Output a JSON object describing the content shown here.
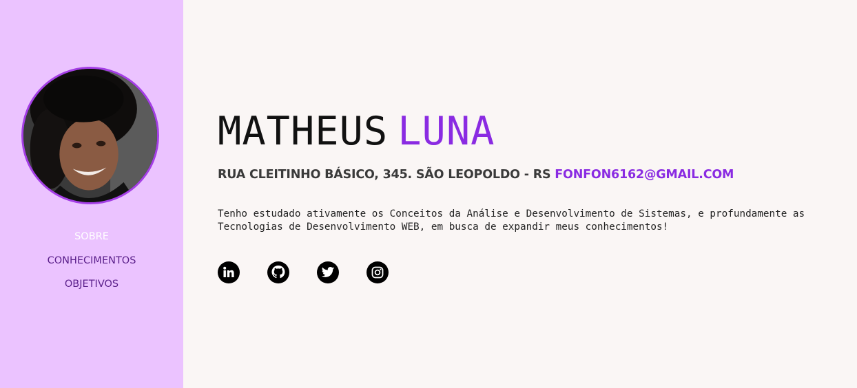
{
  "profile": {
    "first_name": "MATHEUS",
    "last_name": "LUNA",
    "address": "RUA CLEITINHO BÁSICO, 345. SÃO LEOPOLDO - RS",
    "email": "FONFON6162@GMAIL.COM",
    "bio_line1": "Tenho estudado ativamente os Conceitos da Análise e Desenvolvimento de Sistemas, e profundamente as",
    "bio_line2": "Tecnologias de Desenvolvimento WEB, em busca de expandir meus conhecimentos!"
  },
  "sidebar": {
    "nav": [
      {
        "label": "SOBRE",
        "active": true
      },
      {
        "label": "CONHECIMENTOS",
        "active": false
      },
      {
        "label": "OBJETIVOS",
        "active": false
      }
    ]
  },
  "socials": [
    {
      "icon": "linkedin-icon"
    },
    {
      "icon": "github-icon"
    },
    {
      "icon": "twitter-icon"
    },
    {
      "icon": "instagram-icon"
    }
  ],
  "colors": {
    "sidebar_bg": "#ebc3ff",
    "accent": "#8a2be2",
    "page_bg": "#faf6f5",
    "nav_active": "#ffffff",
    "nav_text": "#5a1f8a"
  }
}
